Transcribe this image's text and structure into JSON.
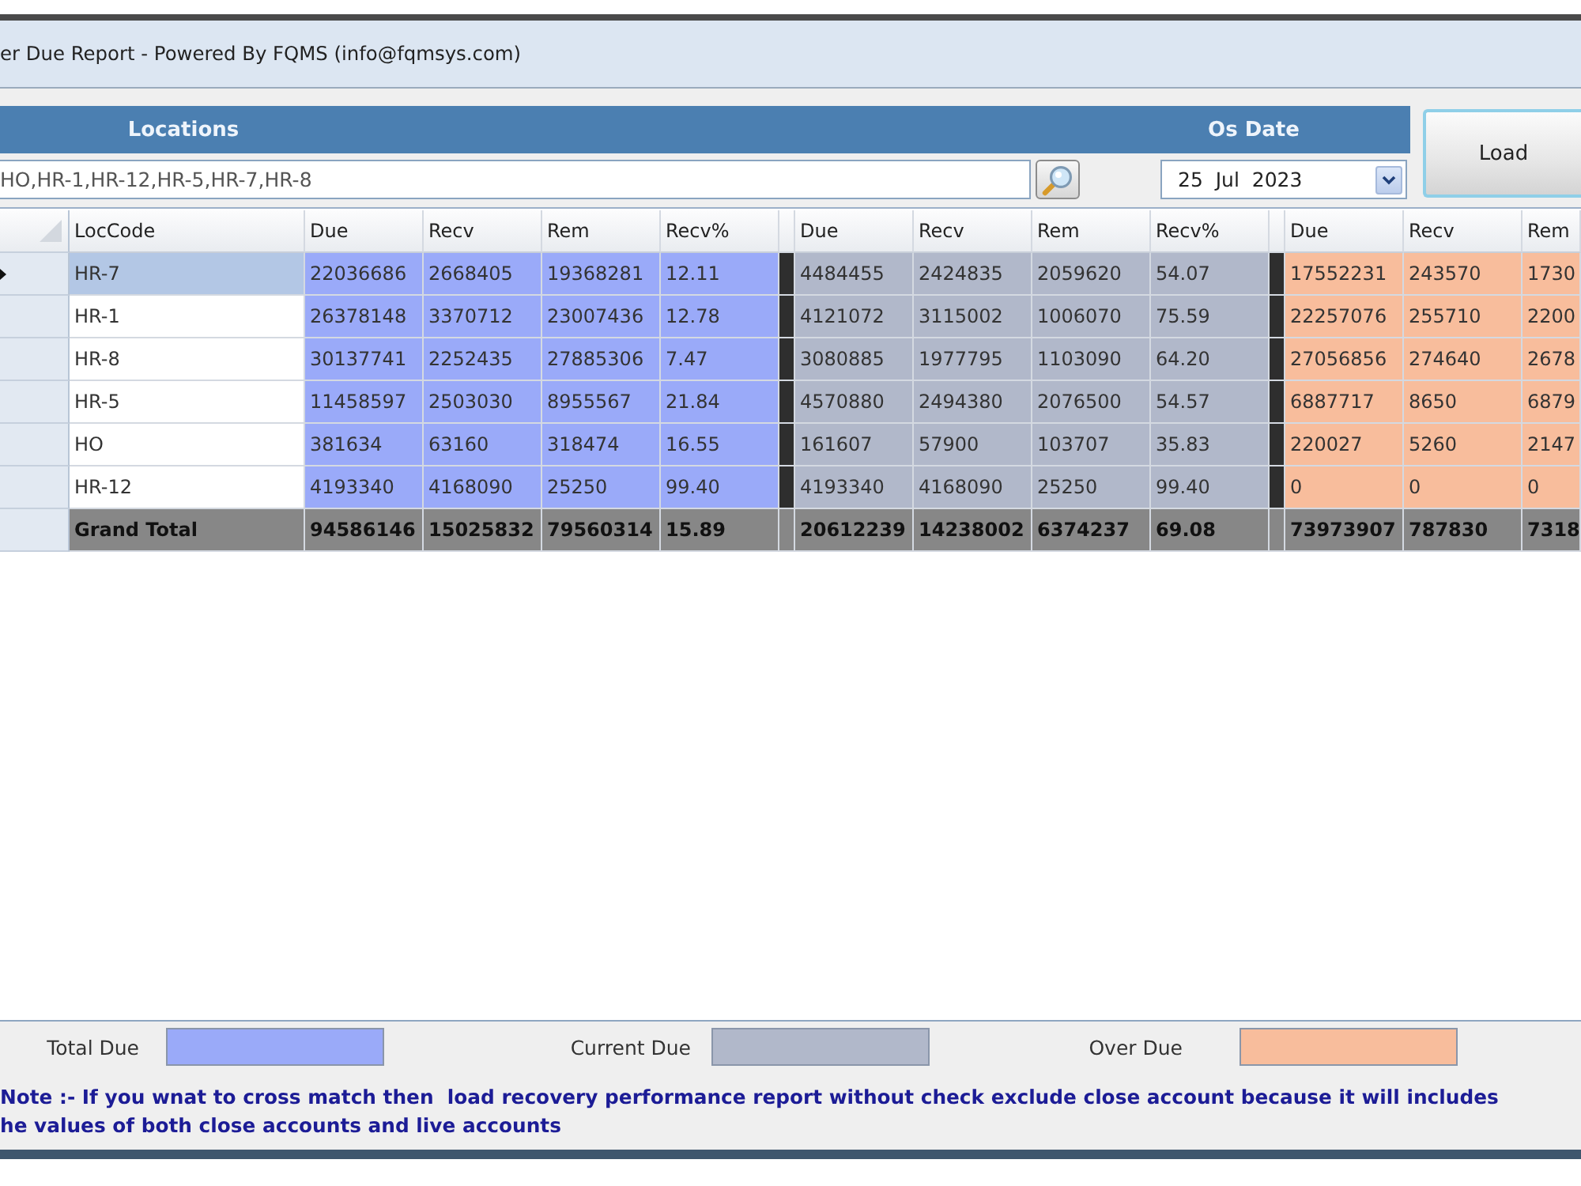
{
  "window": {
    "title": "er Due Report - Powered By FQMS (info@fqmsys.com)"
  },
  "filters": {
    "locations_label": "Locations",
    "os_date_label": "Os Date",
    "locations_value": "HO,HR-1,HR-12,HR-5,HR-7,HR-8",
    "os_date_value": "25  Jul  2023",
    "load_button": "Load"
  },
  "grid": {
    "loc_header": "LocCode",
    "groups": [
      {
        "color": "#9aaaf9",
        "headers": [
          "Due",
          "Recv",
          "Rem",
          "Recv%"
        ]
      },
      {
        "color": "#b1b8ca",
        "headers": [
          "Due",
          "Recv",
          "Rem",
          "Recv%"
        ]
      },
      {
        "color": "#f8bd9c",
        "headers": [
          "Due",
          "Recv",
          "Rem"
        ]
      }
    ],
    "rows": [
      {
        "loc": "HR-7",
        "selected": true,
        "values": [
          [
            "22036686",
            "2668405",
            "19368281",
            "12.11"
          ],
          [
            "4484455",
            "2424835",
            "2059620",
            "54.07"
          ],
          [
            "17552231",
            "243570",
            "1730"
          ]
        ]
      },
      {
        "loc": "HR-1",
        "selected": false,
        "values": [
          [
            "26378148",
            "3370712",
            "23007436",
            "12.78"
          ],
          [
            "4121072",
            "3115002",
            "1006070",
            "75.59"
          ],
          [
            "22257076",
            "255710",
            "2200"
          ]
        ]
      },
      {
        "loc": "HR-8",
        "selected": false,
        "values": [
          [
            "30137741",
            "2252435",
            "27885306",
            "7.47"
          ],
          [
            "3080885",
            "1977795",
            "1103090",
            "64.20"
          ],
          [
            "27056856",
            "274640",
            "2678"
          ]
        ]
      },
      {
        "loc": "HR-5",
        "selected": false,
        "values": [
          [
            "11458597",
            "2503030",
            "8955567",
            "21.84"
          ],
          [
            "4570880",
            "2494380",
            "2076500",
            "54.57"
          ],
          [
            "6887717",
            "8650",
            "6879"
          ]
        ]
      },
      {
        "loc": "HO",
        "selected": false,
        "values": [
          [
            "381634",
            "63160",
            "318474",
            "16.55"
          ],
          [
            "161607",
            "57900",
            "103707",
            "35.83"
          ],
          [
            "220027",
            "5260",
            "2147"
          ]
        ]
      },
      {
        "loc": "HR-12",
        "selected": false,
        "values": [
          [
            "4193340",
            "4168090",
            "25250",
            "99.40"
          ],
          [
            "4193340",
            "4168090",
            "25250",
            "99.40"
          ],
          [
            "0",
            "0",
            "0"
          ]
        ]
      }
    ],
    "total": {
      "label": "Grand Total",
      "values": [
        [
          "94586146",
          "15025832",
          "79560314",
          "15.89"
        ],
        [
          "20612239",
          "14238002",
          "6374237",
          "69.08"
        ],
        [
          "73973907",
          "787830",
          "7318"
        ]
      ]
    }
  },
  "legend": [
    {
      "label": "Total Due",
      "color": "#9aaaf9"
    },
    {
      "label": "Current Due",
      "color": "#b1b8ca"
    },
    {
      "label": "Over Due",
      "color": "#f8bd9c"
    }
  ],
  "note_lines": [
    "Note :- If you wnat to cross match then  load recovery performance report without check exclude close account because it will includes",
    "he values of both close accounts and live accounts"
  ]
}
